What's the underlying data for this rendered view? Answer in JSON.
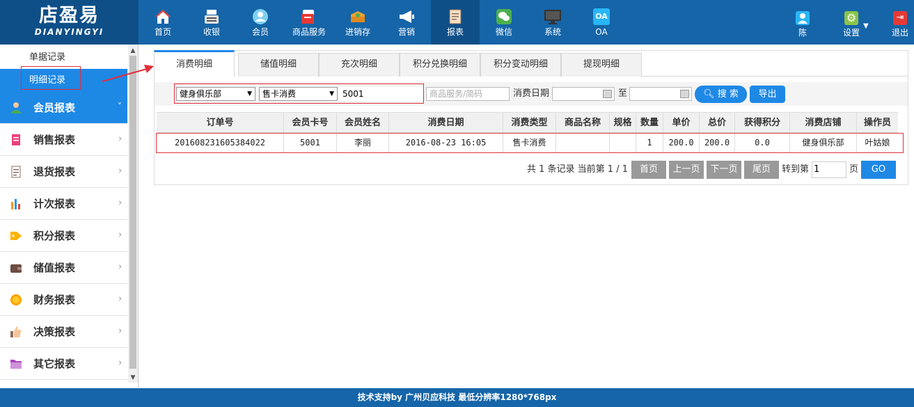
{
  "logo": {
    "cn": "店盈易",
    "en": "DIANYINGYI"
  },
  "nav": [
    {
      "label": "首页",
      "icon": "home-icon"
    },
    {
      "label": "收银",
      "icon": "cash-register-icon"
    },
    {
      "label": "会员",
      "icon": "member-icon"
    },
    {
      "label": "商品服务",
      "icon": "goods-icon"
    },
    {
      "label": "进销存",
      "icon": "inventory-icon"
    },
    {
      "label": "营销",
      "icon": "megaphone-icon"
    },
    {
      "label": "报表",
      "icon": "report-icon"
    },
    {
      "label": "微信",
      "icon": "wechat-icon"
    },
    {
      "label": "系统",
      "icon": "monitor-icon"
    },
    {
      "label": "OA",
      "icon": "oa-icon",
      "badge": "OA"
    }
  ],
  "user": {
    "name": "陈",
    "settings": "设置",
    "logout": "退出"
  },
  "sidebar": {
    "sub_items": [
      "单据记录",
      "明细记录"
    ],
    "menu": [
      {
        "label": "会员报表",
        "icon": "member-report-icon"
      },
      {
        "label": "销售报表",
        "icon": "sales-report-icon"
      },
      {
        "label": "退货报表",
        "icon": "return-report-icon"
      },
      {
        "label": "计次报表",
        "icon": "count-report-icon"
      },
      {
        "label": "积分报表",
        "icon": "points-tag-icon"
      },
      {
        "label": "储值报表",
        "icon": "wallet-icon"
      },
      {
        "label": "财务报表",
        "icon": "coin-icon"
      },
      {
        "label": "决策报表",
        "icon": "thumbs-up-icon"
      },
      {
        "label": "其它报表",
        "icon": "folder-icon"
      }
    ]
  },
  "tabs": [
    "消费明细",
    "储值明细",
    "充次明细",
    "积分兑换明细",
    "积分变动明细",
    "提现明细"
  ],
  "filter": {
    "store": "健身俱乐部",
    "type": "售卡消费",
    "card": "5001",
    "goods_placeholder": "商品服务/简码",
    "date_label": "消费日期",
    "to_label": "至",
    "search": "搜 索",
    "export": "导出"
  },
  "table": {
    "headers": [
      "订单号",
      "会员卡号",
      "会员姓名",
      "消费日期",
      "消费类型",
      "商品名称",
      "规格",
      "数量",
      "单价",
      "总价",
      "获得积分",
      "消费店铺",
      "操作员"
    ],
    "rows": [
      [
        "201608231605384022",
        "5001",
        "李丽",
        "2016-08-23 16:05",
        "售卡消费",
        "",
        "",
        "1",
        "200.0",
        "200.0",
        "0.0",
        "健身俱乐部",
        "叶姑娘"
      ]
    ]
  },
  "pagination": {
    "info": "共 1 条记录 当前第 1 / 1",
    "first": "首页",
    "prev": "上一页",
    "next": "下一页",
    "last": "尾页",
    "goto_label": "转到第",
    "page_value": "1",
    "page_unit": "页",
    "go": "GO"
  },
  "footer": "技术支持by 广州贝应科技    最低分辨率1280*768px",
  "colors": {
    "nav_bg": "#1565a8",
    "accent": "#1e88e5",
    "highlight": "#e0303a"
  }
}
